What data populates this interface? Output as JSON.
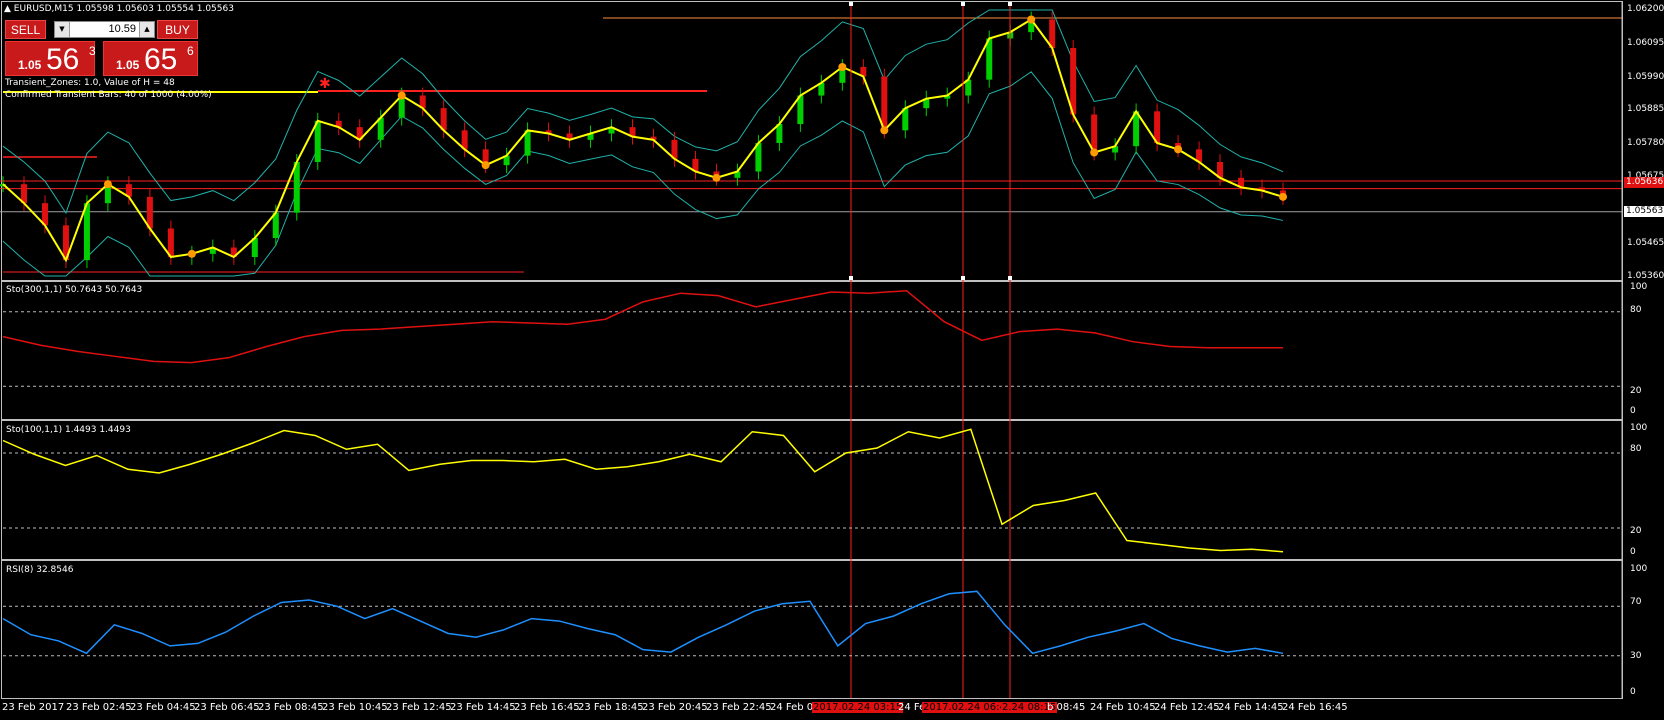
{
  "header": {
    "symbol_info": "EURUSD,M15  1.05598 1.05603 1.05554 1.05563",
    "indicator_line1": "Transient_Zones: 1.0,  Value of H = 48",
    "indicator_line2": "Confirmed Transient Bars: 40 of 1000 (4.00%)"
  },
  "trade_panel": {
    "sell_label": "SELL",
    "buy_label": "BUY",
    "lot_value": "10.59",
    "sell_price": {
      "prefix": "1.05",
      "big": "56",
      "sup": "3"
    },
    "buy_price": {
      "prefix": "1.05",
      "big": "65",
      "sup": "6"
    }
  },
  "price_axis": {
    "labels": [
      "1.06200",
      "1.06095",
      "1.05990",
      "1.05885",
      "1.05780",
      "1.05675",
      "1.05570",
      "1.05465",
      "1.05360"
    ],
    "red_price_box": "1.05636",
    "current_price_box": "1.05563"
  },
  "panels": [
    {
      "id": "sto300",
      "label": "Sto(300,1,1) 50.7643 50.7643",
      "scale": [
        "100",
        "80",
        "20",
        "0"
      ],
      "color": "#e01010"
    },
    {
      "id": "sto100",
      "label": "Sto(100,1,1) 1.4493 1.4493",
      "scale": [
        "100",
        "80",
        "20",
        "0"
      ],
      "color": "#ffff00"
    },
    {
      "id": "rsi",
      "label": "RSI(8) 32.8546",
      "scale": [
        "100",
        "70",
        "30",
        "0"
      ],
      "color": "#1e90ff"
    }
  ],
  "time_axis": {
    "labels": [
      "23 Feb 2017",
      "23 Feb 02:45",
      "23 Feb 04:45",
      "23 Feb 06:45",
      "23 Feb 08:45",
      "23 Feb 10:45",
      "23 Feb 12:45",
      "23 Feb 14:45",
      "23 Feb 16:45",
      "23 Feb 18:45",
      "23 Feb 20:45",
      "23 Feb 22:45",
      "24 Feb 00",
      "24 Feb",
      "b 08:45",
      "24 Feb 10:45",
      "24 Feb 12:45",
      "24 Feb 14:45",
      "24 Feb 16:45"
    ],
    "highlights": [
      "2017.02.24 03:15",
      "2017.02.24 06:45",
      "2.24 08:15"
    ]
  },
  "colors": {
    "background": "#000000",
    "bull_candle": "#00d000",
    "bear_candle": "#e01010",
    "zigzag": "#ffff00",
    "bands": "#20b2aa",
    "markers": "#ff9900",
    "level_lines": "#ff2020"
  },
  "chart_data": {
    "type": "line",
    "symbol": "EURUSD",
    "timeframe": "M15",
    "ylim": [
      1.0536,
      1.062
    ],
    "price_close": [
      1.0565,
      1.0559,
      1.0552,
      1.0541,
      1.0559,
      1.0565,
      1.0561,
      1.0551,
      1.0542,
      1.0543,
      1.0545,
      1.0542,
      1.0548,
      1.0556,
      1.0572,
      1.0585,
      1.0583,
      1.0579,
      1.0586,
      1.0593,
      1.0589,
      1.0582,
      1.0576,
      1.0571,
      1.0574,
      1.0582,
      1.0581,
      1.0579,
      1.0581,
      1.0583,
      1.058,
      1.0579,
      1.0573,
      1.0569,
      1.0567,
      1.0569,
      1.0578,
      1.0584,
      1.0593,
      1.0597,
      1.0602,
      1.0599,
      1.0582,
      1.0589,
      1.0592,
      1.0593,
      1.0598,
      1.0611,
      1.0613,
      1.0617,
      1.0608,
      1.0587,
      1.0575,
      1.0577,
      1.0588,
      1.0578,
      1.0576,
      1.0572,
      1.0567,
      1.0564,
      1.0563,
      1.0561
    ],
    "support_levels": [
      1.05636,
      1.05563
    ],
    "sto300": [
      60,
      53,
      48,
      44,
      40,
      39,
      43,
      52,
      60,
      65,
      66,
      68,
      70,
      72,
      71,
      70,
      74,
      88,
      95,
      93,
      84,
      90,
      96,
      95,
      97,
      72,
      57,
      64,
      66,
      63,
      56,
      52,
      51,
      51,
      51
    ],
    "sto100": [
      90,
      79,
      70,
      78,
      67,
      64,
      71,
      79,
      88,
      98,
      94,
      83,
      87,
      66,
      71,
      74,
      74,
      73,
      75,
      67,
      69,
      73,
      79,
      73,
      97,
      94,
      65,
      80,
      84,
      97,
      92,
      99,
      23,
      38,
      42,
      48,
      10,
      7,
      4,
      2,
      3,
      1
    ],
    "rsi8": [
      60,
      47,
      42,
      32,
      55,
      48,
      38,
      40,
      49,
      62,
      73,
      75,
      70,
      60,
      68,
      58,
      48,
      45,
      51,
      60,
      58,
      52,
      47,
      35,
      33,
      45,
      55,
      66,
      72,
      74,
      38,
      56,
      62,
      72,
      80,
      82,
      55,
      32,
      38,
      45,
      50,
      56,
      44,
      38,
      33,
      36,
      32
    ],
    "xlabel": "",
    "ylabel": ""
  }
}
